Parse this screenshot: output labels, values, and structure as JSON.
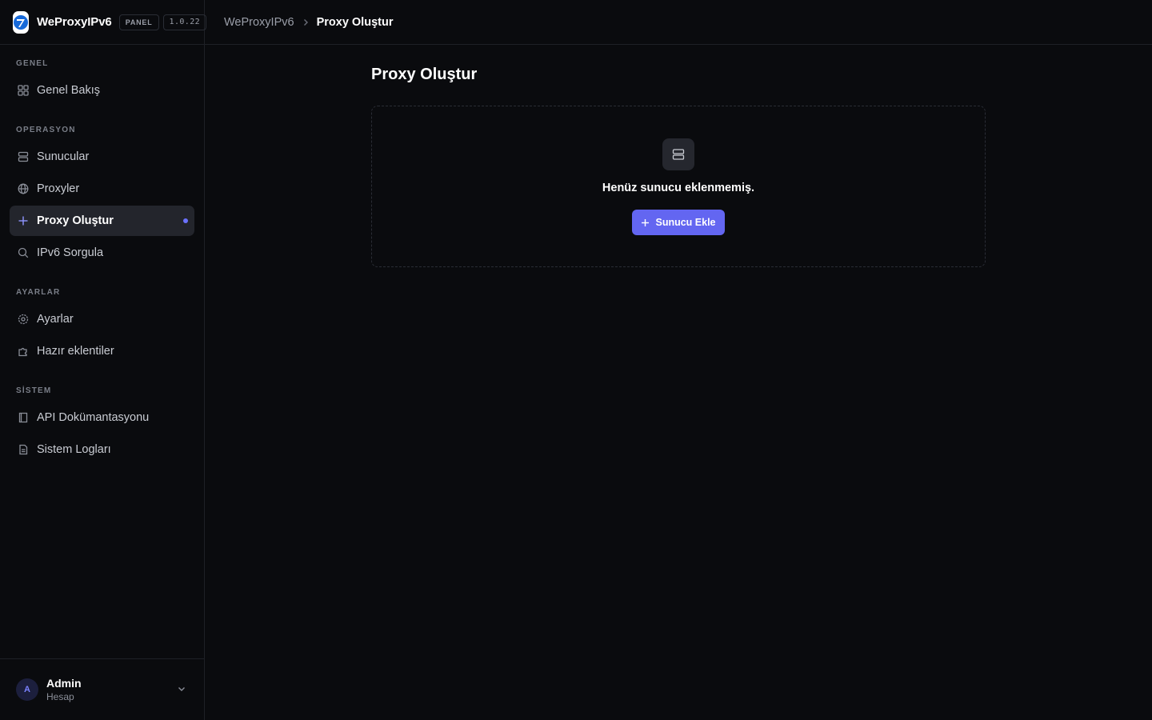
{
  "brand": {
    "name": "WeProxyIPv6",
    "chip": "PANEL",
    "version": "1.0.22"
  },
  "breadcrumb": {
    "root": "WeProxyIPv6",
    "current": "Proxy Oluştur"
  },
  "sidebar": {
    "sections": [
      {
        "label": "GENEL",
        "items": [
          {
            "label": "Genel Bakış",
            "icon": "grid-icon"
          }
        ]
      },
      {
        "label": "OPERASYON",
        "items": [
          {
            "label": "Sunucular",
            "icon": "server-icon"
          },
          {
            "label": "Proxyler",
            "icon": "globe-icon"
          },
          {
            "label": "Proxy Oluştur",
            "icon": "plus-icon",
            "active": true
          },
          {
            "label": "IPv6 Sorgula",
            "icon": "search-icon"
          }
        ]
      },
      {
        "label": "AYARLAR",
        "items": [
          {
            "label": "Ayarlar",
            "icon": "gear-icon"
          },
          {
            "label": "Hazır eklentiler",
            "icon": "puzzle-icon"
          }
        ]
      },
      {
        "label": "SİSTEM",
        "items": [
          {
            "label": "API Dokümantasyonu",
            "icon": "book-icon"
          },
          {
            "label": "Sistem Logları",
            "icon": "file-text-icon"
          }
        ]
      }
    ]
  },
  "user": {
    "initial": "A",
    "name": "Admin",
    "role": "Hesap"
  },
  "main": {
    "title": "Proxy Oluştur",
    "empty_state": {
      "message": "Henüz sunucu eklenmemiş.",
      "button_label": "Sunucu Ekle"
    }
  },
  "colors": {
    "accent": "#6366f1",
    "background": "#0a0b0e",
    "active_dot": "#6b71ff"
  }
}
